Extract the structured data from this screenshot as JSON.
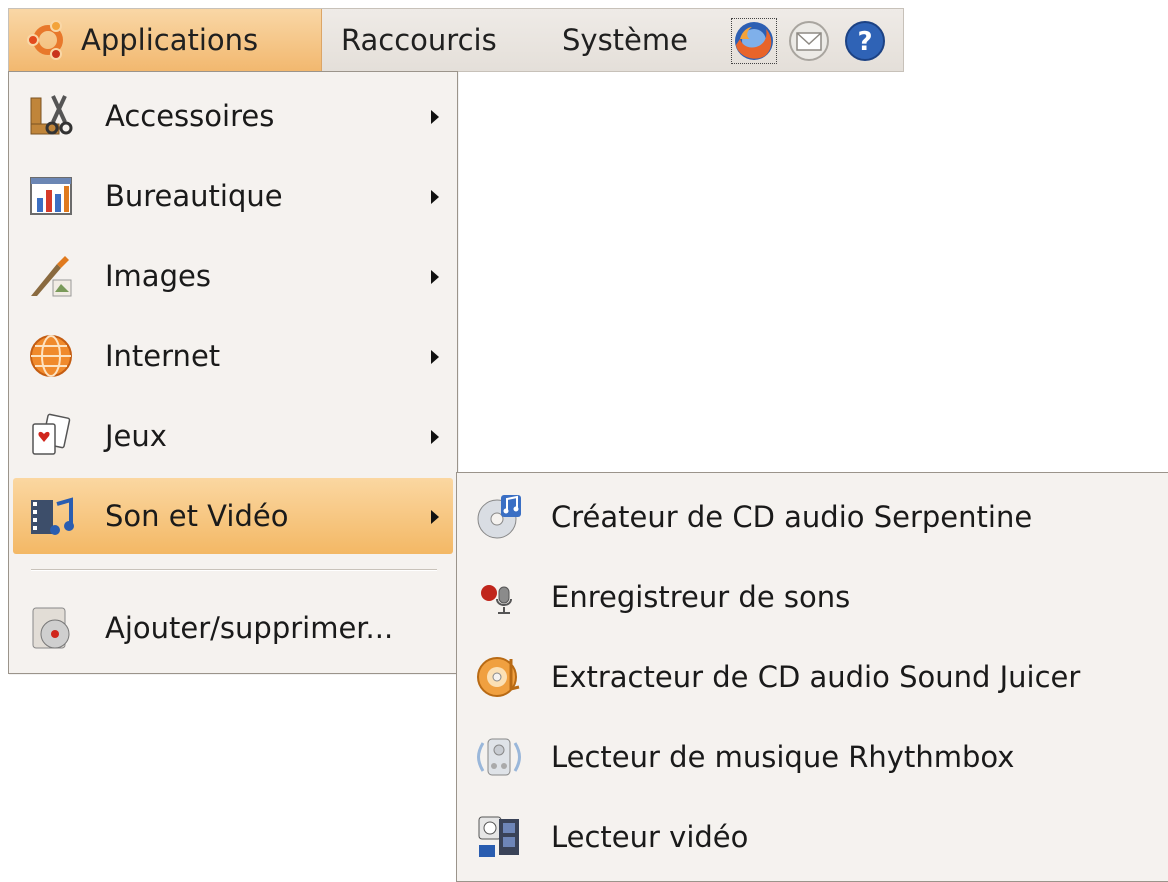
{
  "panel": {
    "applications_label": "Applications",
    "raccourcis_label": "Raccourcis",
    "systeme_label": "Système",
    "launchers": [
      "firefox-icon",
      "mail-icon",
      "help-icon"
    ]
  },
  "main_menu": {
    "items": [
      {
        "label": "Accessoires",
        "icon": "accessories-icon",
        "has_submenu": true
      },
      {
        "label": "Bureautique",
        "icon": "office-icon",
        "has_submenu": true
      },
      {
        "label": "Images",
        "icon": "graphics-icon",
        "has_submenu": true
      },
      {
        "label": "Internet",
        "icon": "internet-icon",
        "has_submenu": true
      },
      {
        "label": "Jeux",
        "icon": "games-icon",
        "has_submenu": true
      },
      {
        "label": "Son et Vidéo",
        "icon": "multimedia-icon",
        "has_submenu": true,
        "active": true
      }
    ],
    "footer_item": {
      "label": "Ajouter/supprimer...",
      "icon": "add-remove-icon"
    }
  },
  "submenu": {
    "parent": "Son et Vidéo",
    "items": [
      {
        "label": "Créateur de CD audio Serpentine",
        "icon": "cd-creator-icon"
      },
      {
        "label": "Enregistreur de sons",
        "icon": "sound-recorder-icon"
      },
      {
        "label": "Extracteur de CD audio Sound Juicer",
        "icon": "cd-extractor-icon"
      },
      {
        "label": "Lecteur de musique Rhythmbox",
        "icon": "music-player-icon"
      },
      {
        "label": "Lecteur vidéo",
        "icon": "video-player-icon"
      }
    ]
  },
  "colors": {
    "panel_bg": "#e9e5e0",
    "highlight": "#f3b865",
    "menu_bg": "#f5f2ef",
    "menu_border": "#9b948b"
  }
}
